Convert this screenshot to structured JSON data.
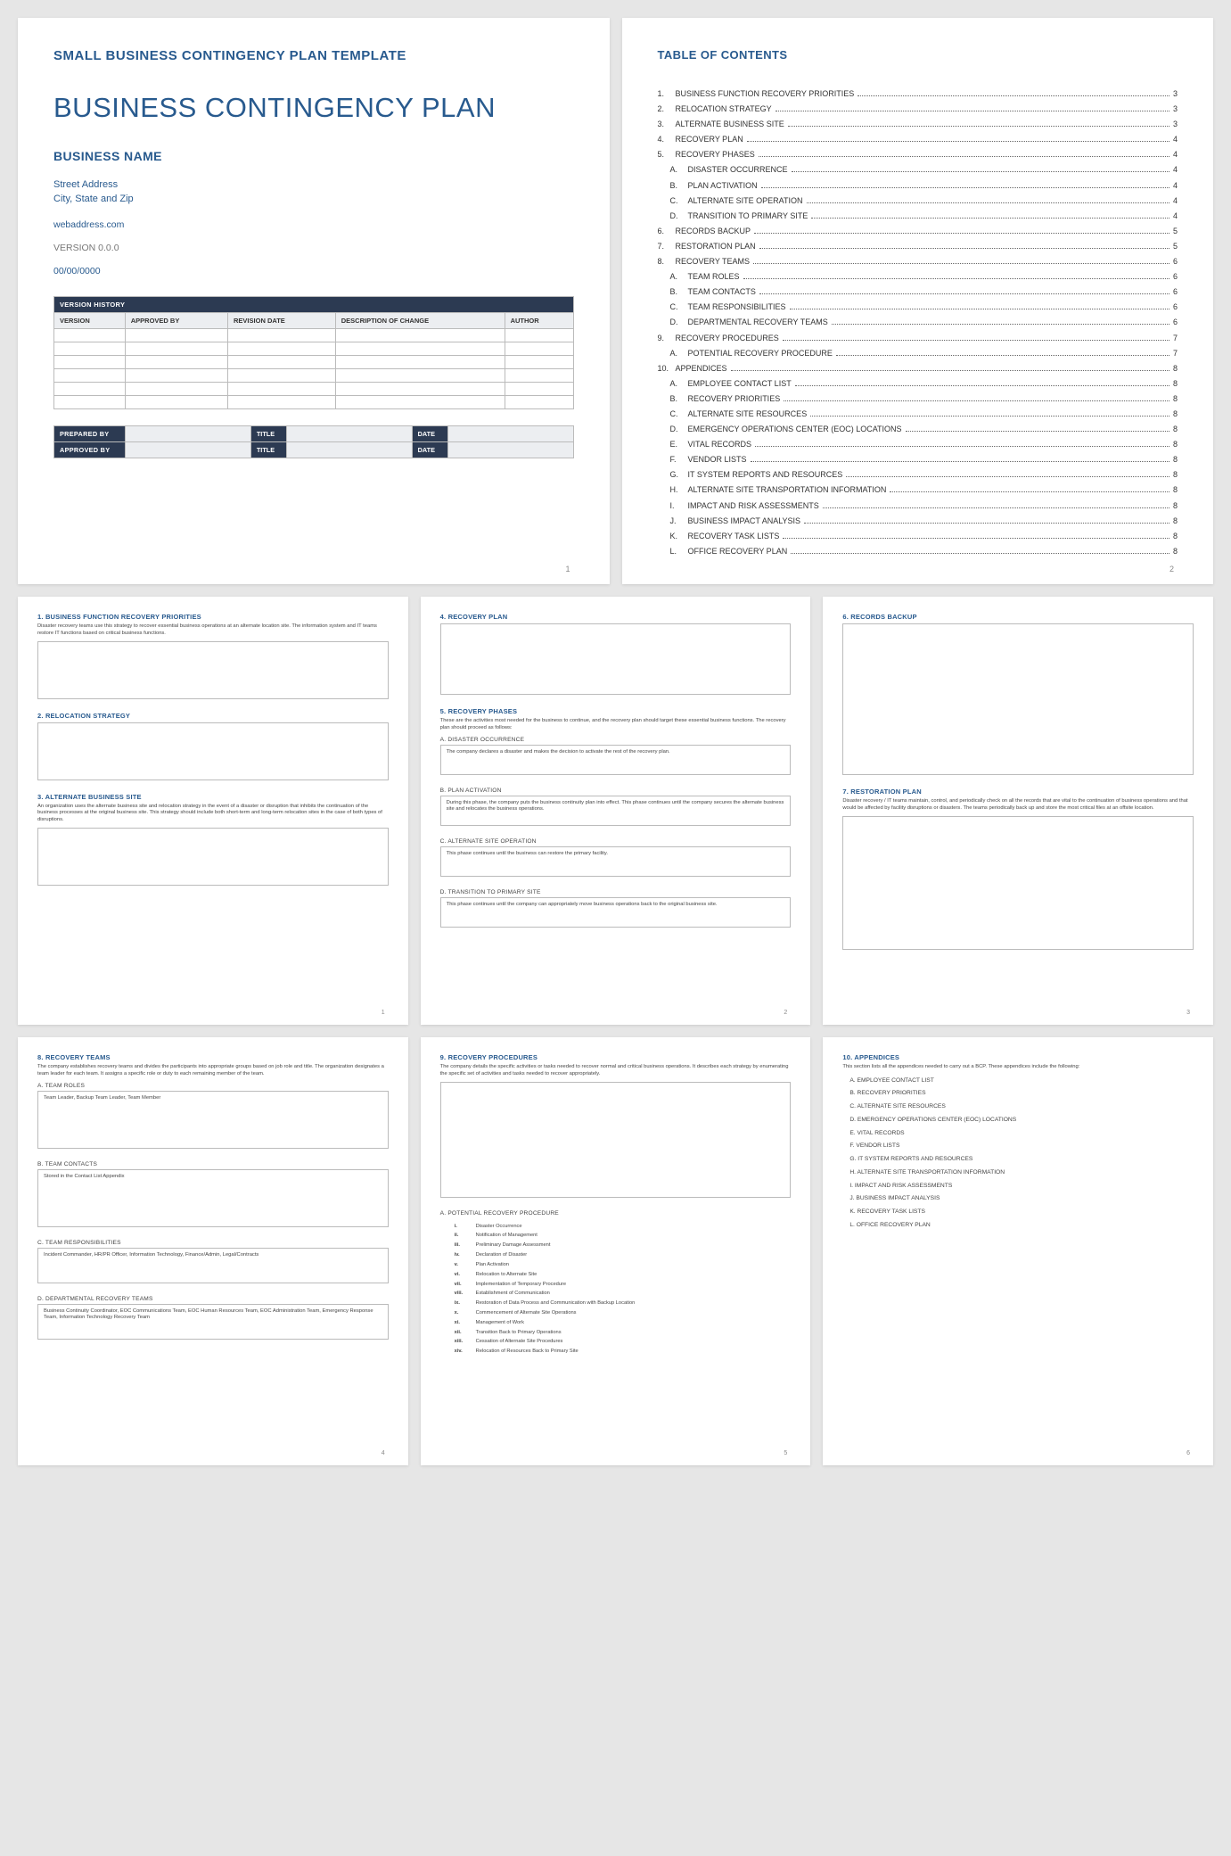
{
  "page1": {
    "superTitle": "SMALL BUSINESS CONTINGENCY PLAN TEMPLATE",
    "docTitle": "BUSINESS CONTINGENCY PLAN",
    "bizName": "BUSINESS NAME",
    "street": "Street Address",
    "cityZip": "City, State and Zip",
    "web": "webaddress.com",
    "version": "VERSION 0.0.0",
    "date": "00/00/0000",
    "vhHeader": "VERSION HISTORY",
    "vhCols": [
      "VERSION",
      "APPROVED BY",
      "REVISION DATE",
      "DESCRIPTION OF CHANGE",
      "AUTHOR"
    ],
    "sign": {
      "preparedBy": "PREPARED BY",
      "approvedBy": "APPROVED BY",
      "title": "TITLE",
      "date": "DATE"
    },
    "pageNum": "1"
  },
  "page2": {
    "title": "TABLE OF CONTENTS",
    "items": [
      {
        "m": "1.",
        "t": "BUSINESS FUNCTION RECOVERY PRIORITIES",
        "p": "3"
      },
      {
        "m": "2.",
        "t": "RELOCATION STRATEGY",
        "p": "3"
      },
      {
        "m": "3.",
        "t": "ALTERNATE BUSINESS SITE",
        "p": "3"
      },
      {
        "m": "4.",
        "t": "RECOVERY PLAN",
        "p": "4"
      },
      {
        "m": "5.",
        "t": "RECOVERY PHASES",
        "p": "4"
      },
      {
        "m": "A.",
        "t": "DISASTER OCCURRENCE",
        "p": "4",
        "sub": true
      },
      {
        "m": "B.",
        "t": "PLAN ACTIVATION",
        "p": "4",
        "sub": true
      },
      {
        "m": "C.",
        "t": "ALTERNATE SITE OPERATION",
        "p": "4",
        "sub": true
      },
      {
        "m": "D.",
        "t": "TRANSITION TO PRIMARY SITE",
        "p": "4",
        "sub": true
      },
      {
        "m": "6.",
        "t": "RECORDS BACKUP",
        "p": "5"
      },
      {
        "m": "7.",
        "t": "RESTORATION PLAN",
        "p": "5"
      },
      {
        "m": "8.",
        "t": "RECOVERY TEAMS",
        "p": "6"
      },
      {
        "m": "A.",
        "t": "TEAM ROLES",
        "p": "6",
        "sub": true
      },
      {
        "m": "B.",
        "t": "TEAM CONTACTS",
        "p": "6",
        "sub": true
      },
      {
        "m": "C.",
        "t": "TEAM RESPONSIBILITIES",
        "p": "6",
        "sub": true
      },
      {
        "m": "D.",
        "t": "DEPARTMENTAL RECOVERY TEAMS",
        "p": "6",
        "sub": true
      },
      {
        "m": "9.",
        "t": "RECOVERY PROCEDURES",
        "p": "7"
      },
      {
        "m": "A.",
        "t": "POTENTIAL RECOVERY PROCEDURE",
        "p": "7",
        "sub": true
      },
      {
        "m": "10.",
        "t": "APPENDICES",
        "p": "8"
      },
      {
        "m": "A.",
        "t": "EMPLOYEE CONTACT LIST",
        "p": "8",
        "sub": true
      },
      {
        "m": "B.",
        "t": "RECOVERY PRIORITIES",
        "p": "8",
        "sub": true
      },
      {
        "m": "C.",
        "t": "ALTERNATE SITE RESOURCES",
        "p": "8",
        "sub": true
      },
      {
        "m": "D.",
        "t": "EMERGENCY OPERATIONS CENTER (EOC) LOCATIONS",
        "p": "8",
        "sub": true
      },
      {
        "m": "E.",
        "t": "VITAL RECORDS",
        "p": "8",
        "sub": true
      },
      {
        "m": "F.",
        "t": "VENDOR LISTS",
        "p": "8",
        "sub": true
      },
      {
        "m": "G.",
        "t": "IT SYSTEM REPORTS AND RESOURCES",
        "p": "8",
        "sub": true
      },
      {
        "m": "H.",
        "t": "ALTERNATE SITE TRANSPORTATION INFORMATION",
        "p": "8",
        "sub": true
      },
      {
        "m": "I.",
        "t": "IMPACT AND RISK ASSESSMENTS",
        "p": "8",
        "sub": true
      },
      {
        "m": "J.",
        "t": "BUSINESS IMPACT ANALYSIS",
        "p": "8",
        "sub": true
      },
      {
        "m": "K.",
        "t": "RECOVERY TASK LISTS",
        "p": "8",
        "sub": true
      },
      {
        "m": "L.",
        "t": "OFFICE RECOVERY PLAN",
        "p": "8",
        "sub": true
      }
    ],
    "pageNum": "2"
  },
  "p3": {
    "s1h": "1. BUSINESS FUNCTION RECOVERY PRIORITIES",
    "s1d": "Disaster recovery teams use this strategy to recover essential business operations at an alternate location site. The information system and IT teams restore IT functions based on critical business functions.",
    "s2h": "2. RELOCATION STRATEGY",
    "s3h": "3. ALTERNATE BUSINESS SITE",
    "s3d": "An organization uses the alternate business site and relocation strategy in the event of a disaster or disruption that inhibits the continuation of the business processes at the original business site. This strategy should include both short-term and long-term relocation sites in the case of both types of disruptions.",
    "num": "1"
  },
  "p4": {
    "s4h": "4. RECOVERY PLAN",
    "s5h": "5. RECOVERY PHASES",
    "s5d": "These are the activities most needed for the business to continue, and the recovery plan should target these essential business functions. The recovery plan should proceed as follows:",
    "aH": "A. DISASTER OCCURRENCE",
    "aT": "The company declares a disaster and makes the decision to activate the rest of the recovery plan.",
    "bH": "B. PLAN ACTIVATION",
    "bT": "During this phase, the company puts the business continuity plan into effect. This phase continues until the company secures the alternate business site and relocates the business operations.",
    "cH": "C. ALTERNATE SITE OPERATION",
    "cT": "This phase continues until the business can restore the primary facility.",
    "dH": "D. TRANSITION TO PRIMARY SITE",
    "dT": "This phase continues until the company can appropriately move business operations back to the original business site.",
    "num": "2"
  },
  "p5": {
    "s6h": "6. RECORDS BACKUP",
    "s7h": "7. RESTORATION PLAN",
    "s7d": "Disaster recovery / IT teams maintain, control, and periodically check on all the records that are vital to the continuation of business operations and that would be affected by facility disruptions or disasters. The teams periodically back up and store the most critical files at an offsite location.",
    "num": "3"
  },
  "p6": {
    "s8h": "8. RECOVERY TEAMS",
    "s8d": "The company establishes recovery teams and divides the participants into appropriate groups based on job role and title. The organization designates a team leader for each team. It assigns a specific role or duty to each remaining member of the team.",
    "aH": "A. TEAM ROLES",
    "aT": "Team Leader, Backup Team Leader, Team Member",
    "bH": "B. TEAM CONTACTS",
    "bT": "Stored in the Contact List Appendix",
    "cH": "C. TEAM RESPONSIBILITIES",
    "cT": "Incident Commander, HR/PR Officer, Information Technology, Finance/Admin, Legal/Contracts",
    "dH": "D. DEPARTMENTAL RECOVERY TEAMS",
    "dT": "Business Continuity Coordinator, EOC Communications Team, EOC Human Resources Team, EOC Administration Team, Emergency Response Team, Information Technology Recovery Team",
    "num": "4"
  },
  "p7": {
    "s9h": "9. RECOVERY PROCEDURES",
    "s9d": "The company details the specific activities or tasks needed to recover normal and critical business operations. It describes each strategy by enumerating the specific set of activities and tasks needed to recover appropriately.",
    "aH": "A. POTENTIAL RECOVERY PROCEDURE",
    "steps": [
      {
        "n": "i.",
        "t": "Disaster Occurrence"
      },
      {
        "n": "ii.",
        "t": "Notification of Management"
      },
      {
        "n": "iii.",
        "t": "Preliminary Damage Assessment"
      },
      {
        "n": "iv.",
        "t": "Declaration of Disaster"
      },
      {
        "n": "v.",
        "t": "Plan Activation"
      },
      {
        "n": "vi.",
        "t": "Relocation to Alternate Site"
      },
      {
        "n": "vii.",
        "t": "Implementation of Temporary Procedure"
      },
      {
        "n": "viii.",
        "t": "Establishment of Communication"
      },
      {
        "n": "ix.",
        "t": "Restoration of Data Process and Communication with Backup Location"
      },
      {
        "n": "x.",
        "t": "Commencement of Alternate Site Operations"
      },
      {
        "n": "xi.",
        "t": "Management of Work"
      },
      {
        "n": "xii.",
        "t": "Transition Back to Primary Operations"
      },
      {
        "n": "xiii.",
        "t": "Cessation of Alternate Site Procedures"
      },
      {
        "n": "xiv.",
        "t": "Relocation of Resources Back to Primary Site"
      }
    ],
    "num": "5"
  },
  "p8": {
    "s10h": "10.   APPENDICES",
    "s10d": "This section lists all the appendices needed to carry out a BCP. These appendices include the following:",
    "items": [
      "A.  EMPLOYEE CONTACT LIST",
      "B.  RECOVERY PRIORITIES",
      "C.  ALTERNATE SITE RESOURCES",
      "D.  EMERGENCY OPERATIONS CENTER (EOC) LOCATIONS",
      "E.  VITAL RECORDS",
      "F.  VENDOR LISTS",
      "G.  IT SYSTEM REPORTS AND RESOURCES",
      "H.  ALTERNATE SITE TRANSPORTATION INFORMATION",
      "I.   IMPACT AND RISK ASSESSMENTS",
      "J.   BUSINESS IMPACT ANALYSIS",
      "K.  RECOVERY TASK LISTS",
      "L.   OFFICE RECOVERY PLAN"
    ],
    "num": "6"
  }
}
